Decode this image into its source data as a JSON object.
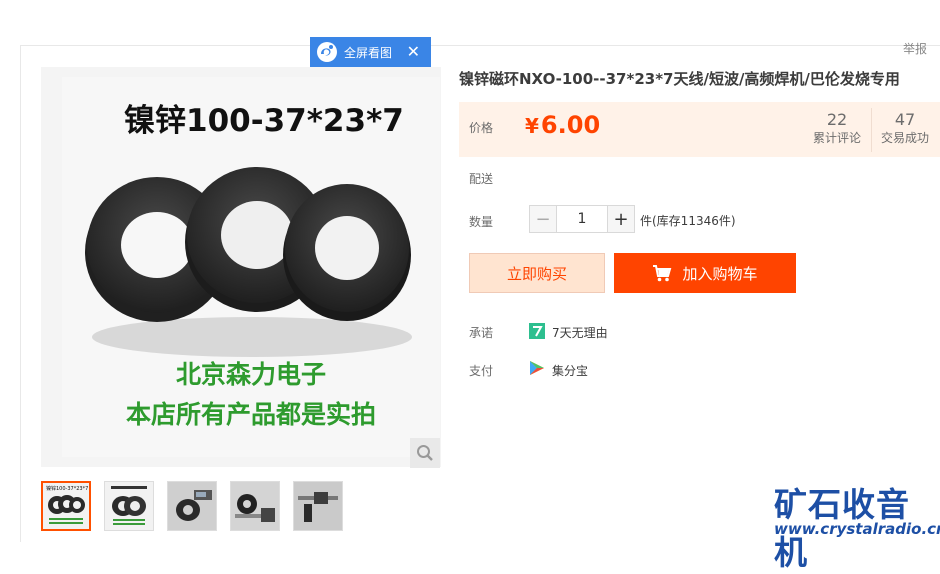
{
  "top_bar": {
    "report": "举报",
    "fullscreen_label": "全屏看图"
  },
  "gallery": {
    "photo_title": "镍锌100-37*23*7",
    "photo_caption_1": "北京森力电子",
    "photo_caption_2": "本店所有产品都是实拍",
    "thumb_caption": "镍锌100-37*23*7",
    "thumb_count": 5,
    "active_thumb": 0
  },
  "product": {
    "title": "镍锌磁环NXO-100--37*23*7天线/短波/高频焊机/巴伦发烧专用",
    "price_label": "价格",
    "currency": "¥",
    "price": "6.00",
    "reviews_count": "22",
    "reviews_label": "累计评论",
    "deals_count": "47",
    "deals_label": "交易成功",
    "shipping_label": "配送",
    "quantity_label": "数量",
    "quantity_value": "1",
    "stock_text": "件(库存11346件)",
    "buy_now": "立即购买",
    "add_to_cart": "加入购物车",
    "promise_label": "承诺",
    "promise_text": "7天无理由",
    "payment_label": "支付",
    "payment_text": "集分宝"
  },
  "watermark": {
    "name": "矿石收音机",
    "url": "www.crystalradio.cn"
  },
  "colors": {
    "accent": "#ff4400",
    "price": "#ff4400",
    "fullscreen_bg": "#3a85e6",
    "watermark": "#1d4fa5"
  }
}
